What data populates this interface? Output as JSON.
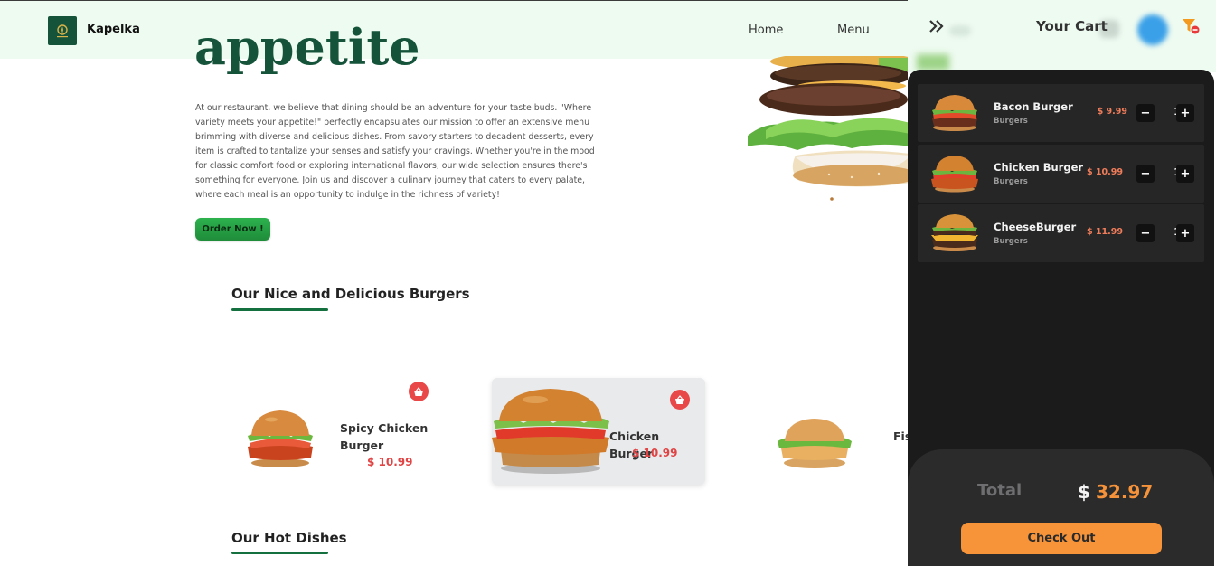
{
  "nav": {
    "brand": "Kapelka",
    "logo_icon": "kapelka-logo-icon",
    "links": [
      "Home",
      "Menu"
    ]
  },
  "hero": {
    "heading": "appetite",
    "paragraph": "At our restaurant, we believe that dining should be an adventure for your taste buds. \"Where variety meets your appetite!\" perfectly encapsulates our mission to offer an extensive menu brimming with diverse and delicious dishes. From savory starters to decadent desserts, every item is crafted to tantalize your senses and satisfy your cravings. Whether you're in the mood for classic comfort food or exploring international flavors, our wide selection ensures there's something for everyone. Join us and discover a culinary journey that caters to every palate, where each meal is an opportunity to indulge in the richness of variety!",
    "order_button": "Order Now !"
  },
  "sections": {
    "burgers_title": "Our Nice and Delicious Burgers",
    "hot_dishes_title": "Our Hot Dishes"
  },
  "products": [
    {
      "name_line1": "Spicy Chicken",
      "name_line2": "Burger",
      "price": "$ 10.99"
    },
    {
      "name": "Chicken Burger",
      "price": "$ 10.99"
    },
    {
      "name_partial": "Fis"
    }
  ],
  "cart": {
    "title": "Your Cart",
    "items": [
      {
        "name": "Bacon Burger",
        "category": "Burgers",
        "price": "$ 9.99",
        "qty": "1"
      },
      {
        "name": "Chicken Burger",
        "category": "Burgers",
        "price": "$ 10.99",
        "qty": "1"
      },
      {
        "name": "CheeseBurger",
        "category": "Burgers",
        "price": "$ 11.99",
        "qty": "1"
      }
    ],
    "total_label": "Total",
    "total_currency": "$",
    "total_value": "32.97",
    "checkout": "Check Out",
    "minus": "−",
    "plus": "+"
  },
  "colors": {
    "brand_green": "#15543a",
    "accent_orange": "#f7943a",
    "price_red": "#e04444",
    "cart_dark": "#1b1b1c"
  }
}
